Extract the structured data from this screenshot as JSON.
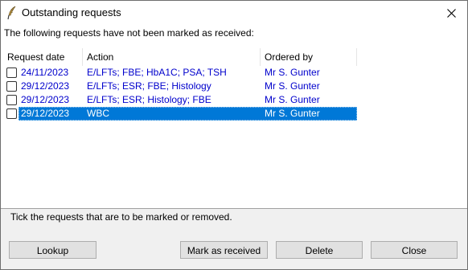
{
  "window": {
    "title": "Outstanding requests",
    "app_icon": "feather-quill-icon",
    "close_icon": "close-icon"
  },
  "intro": "The following requests have not been marked as received:",
  "list": {
    "columns": [
      "Request date",
      "Action",
      "Ordered by"
    ],
    "rows": [
      {
        "date": "24/11/2023",
        "action": "E/LFTs; FBE; HbA1C; PSA; TSH",
        "ordered_by": "Mr S. Gunter",
        "checked": false,
        "selected": false
      },
      {
        "date": "29/12/2023",
        "action": "E/LFTs; ESR; FBE; Histology",
        "ordered_by": "Mr S. Gunter",
        "checked": false,
        "selected": false
      },
      {
        "date": "29/12/2023",
        "action": "E/LFTs; ESR; Histology; FBE",
        "ordered_by": "Mr S. Gunter",
        "checked": false,
        "selected": false
      },
      {
        "date": "29/12/2023",
        "action": "WBC",
        "ordered_by": "Mr S. Gunter",
        "checked": false,
        "selected": true
      }
    ],
    "link_color": "#0000cc",
    "selection_color": "#0078d7"
  },
  "hint": "Tick the requests that are to be marked or removed.",
  "buttons": {
    "lookup": "Lookup",
    "mark_received": "Mark as received",
    "delete": "Delete",
    "close": "Close"
  }
}
